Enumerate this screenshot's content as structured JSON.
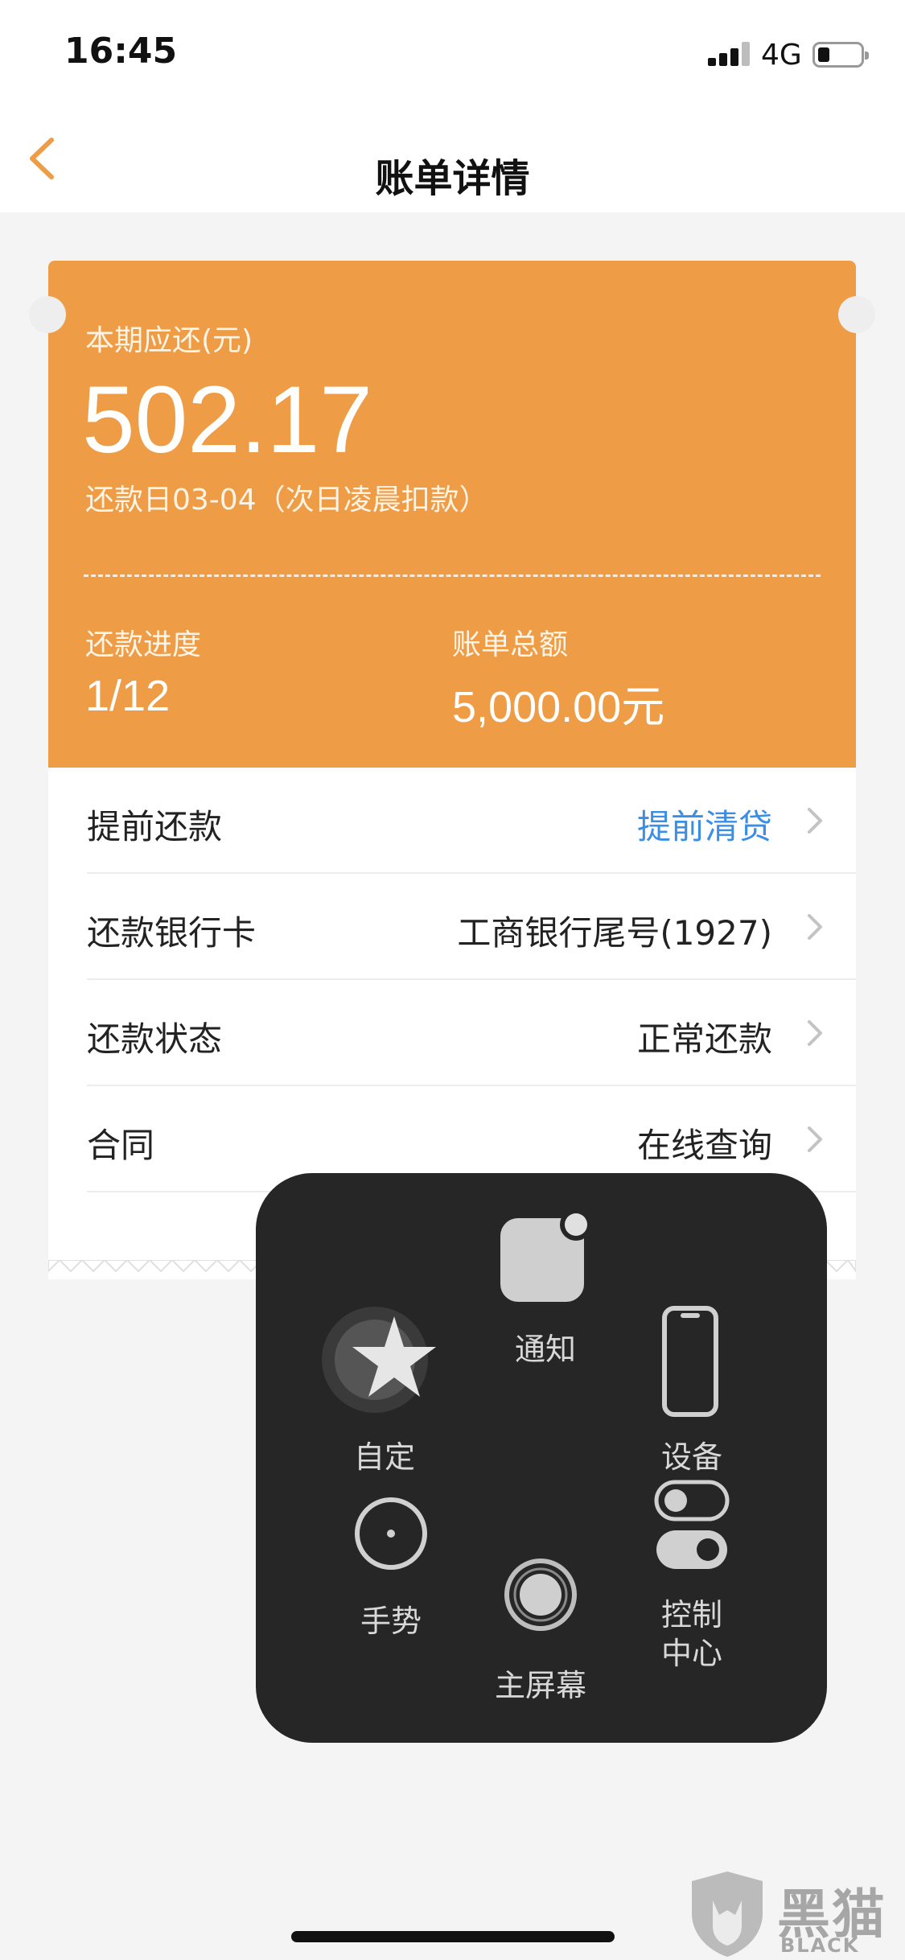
{
  "status_bar": {
    "time": "16:45",
    "network": "4G"
  },
  "nav": {
    "title": "账单详情",
    "back_icon": "chevron-left-icon",
    "accent_color": "#ee9c45"
  },
  "bill": {
    "due_label": "本期应还(元)",
    "due_amount": "502.17",
    "due_date": "还款日03-04（次日凌晨扣款）",
    "progress_label": "还款进度",
    "progress_value": "1/12",
    "total_label": "账单总额",
    "total_value": "5,000.00元"
  },
  "rows": [
    {
      "label": "提前还款",
      "value": "提前清贷",
      "value_color": "#3a8ee6"
    },
    {
      "label": "还款银行卡",
      "value": "工商银行尾号(1927)"
    },
    {
      "label": "还款状态",
      "value": "正常还款"
    },
    {
      "label": "合同",
      "value": "在线查询"
    }
  ],
  "assistive_touch": {
    "notification": "通知",
    "custom": "自定",
    "device": "设备",
    "gesture": "手势",
    "home": "主屏幕",
    "control_center_1": "控制",
    "control_center_2": "中心"
  },
  "watermark": {
    "title": "黑猫",
    "subtitle": "BLACK CAT"
  }
}
